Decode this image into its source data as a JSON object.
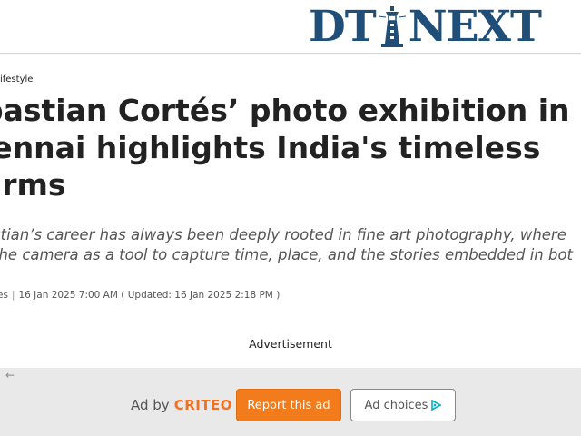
{
  "header": {
    "logo_left": "DT",
    "logo_right": "NEXT"
  },
  "article": {
    "category": "ifestyle",
    "headline_lines": [
      "pastian Cortés’ photo exhibition in",
      "iennai highlights India's timeless",
      "arms"
    ],
    "standfirst_lines": [
      "stian’s career has always been deeply rooted in fine art photography, where",
      "the camera as a tool to capture time, place, and the stories embedded in bot"
    ],
    "meta": {
      "author_fragment": "es",
      "published": "16 Jan 2025 7:00 AM",
      "updated": "( Updated:  16 Jan 2025 2:18 PM  )"
    }
  },
  "ad": {
    "label": "Advertisement",
    "back_arrow": "←",
    "ad_by": "Ad by",
    "brand": "CRITEO",
    "report_label": "Report this ad",
    "choices_label": "Ad choices"
  },
  "colors": {
    "logo": "#1f4e79",
    "criteo": "#f36f21",
    "report_button": "#f27b1b",
    "ad_bar": "#e9e9e9"
  }
}
